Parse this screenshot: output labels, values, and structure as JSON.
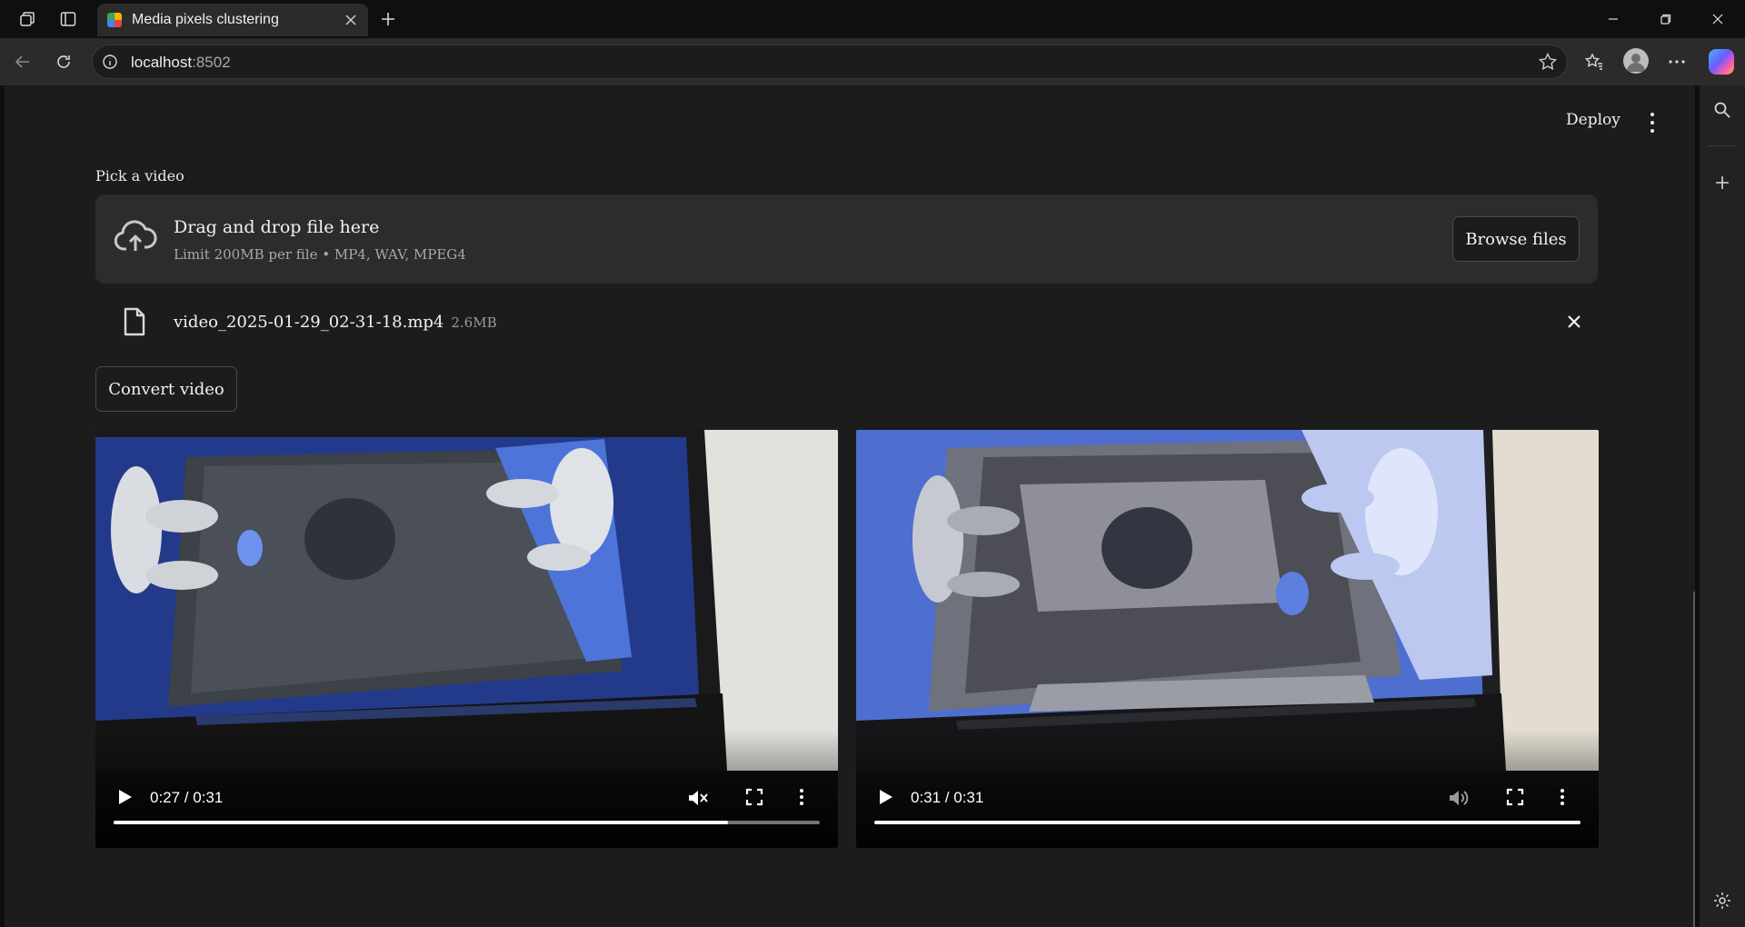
{
  "browser": {
    "tab_title": "Media pixels clustering",
    "url_host": "localhost",
    "url_port": ":8502"
  },
  "app": {
    "deploy_label": "Deploy",
    "uploader": {
      "label": "Pick a video",
      "drop_title": "Drag and drop file here",
      "drop_subtitle": "Limit 200MB per file • MP4, WAV, MPEG4",
      "browse_label": "Browse files"
    },
    "file": {
      "name": "video_2025-01-29_02-31-18.mp4",
      "size": "2.6MB"
    },
    "convert_label": "Convert video",
    "videos": [
      {
        "time": "0:27 / 0:31",
        "progress": 0.87,
        "muted": true,
        "style": "original"
      },
      {
        "time": "0:31 / 0:31",
        "progress": 1.0,
        "muted": false,
        "style": "clustered"
      }
    ]
  },
  "colors": {
    "app_bg": "#1c1c1c",
    "dropzone_bg": "#2c2c2e",
    "chrome_bg": "#2b2b2b",
    "accent_blue": "#3f6fd8"
  },
  "icons": [
    "workspaces-icon",
    "tab-actions-icon",
    "close-icon",
    "plus-icon",
    "minimize-icon",
    "restore-icon",
    "back-icon",
    "reload-icon",
    "info-icon",
    "star-icon",
    "favorites-icon",
    "profile-icon",
    "more-icon",
    "copilot-icon",
    "search-icon",
    "settings-icon",
    "cloud-upload-icon",
    "file-icon",
    "play-icon",
    "volume-icon",
    "fullscreen-icon"
  ]
}
